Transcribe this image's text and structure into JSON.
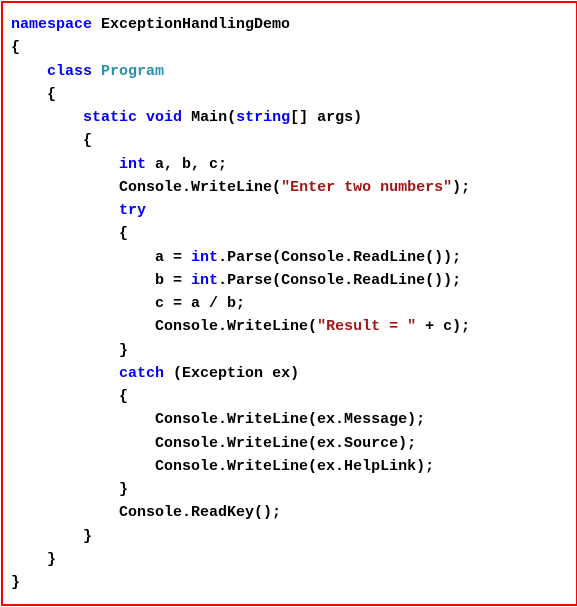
{
  "code": {
    "ns_kw": "namespace",
    "ns_name": " ExceptionHandlingDemo",
    "obrace": "{",
    "cbrace": "}",
    "class_kw": "class",
    "class_name": "Program",
    "static_kw": "static",
    "void_kw": "void",
    "main_name": " Main(",
    "string_kw": "string",
    "main_params": "[] args)",
    "int_kw": "int",
    "vars_decl": " a, b, c;",
    "console_write": "Console.WriteLine(",
    "str_enter": "\"Enter two numbers\"",
    "close_paren_semi": ");",
    "try_kw": "try",
    "catch_kw": "catch",
    "assign_a": "a = ",
    "assign_b": "b = ",
    "parse_call": ".Parse(Console.ReadLine());",
    "div_line": "c = a / b;",
    "str_result": "\"Result = \"",
    "concat_c": " + c);",
    "catch_params": " (Exception ex)",
    "ex_message": "Console.WriteLine(ex.Message);",
    "ex_source": "Console.WriteLine(ex.Source);",
    "ex_helplink": "Console.WriteLine(ex.HelpLink);",
    "readkey": "Console.ReadKey();"
  }
}
